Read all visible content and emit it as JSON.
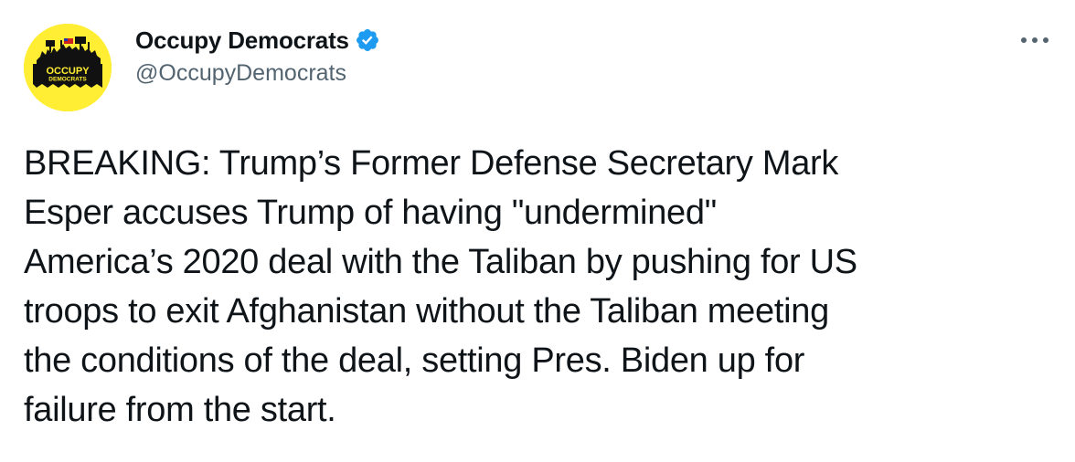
{
  "tweet": {
    "author": {
      "display_name": "Occupy Democrats",
      "handle": "@OccupyDemocrats",
      "verified": true,
      "avatar": {
        "line1": "OCCUPY",
        "line2": "DEMOCRATS",
        "background_color": "#ffee33"
      }
    },
    "more_icon": "more-horizontal-icon",
    "text": "BREAKING: Trump’s Former Defense Secretary Mark\nEsper accuses Trump of having \"undermined\"\nAmerica’s 2020 deal with the Taliban by pushing for US\ntroops to exit Afghanistan without the Taliban meeting\nthe conditions of the deal, setting Pres. Biden up for\nfailure from the start."
  },
  "colors": {
    "text_primary": "#0f1419",
    "text_secondary": "#536471",
    "verified_blue": "#1d9bf0"
  }
}
